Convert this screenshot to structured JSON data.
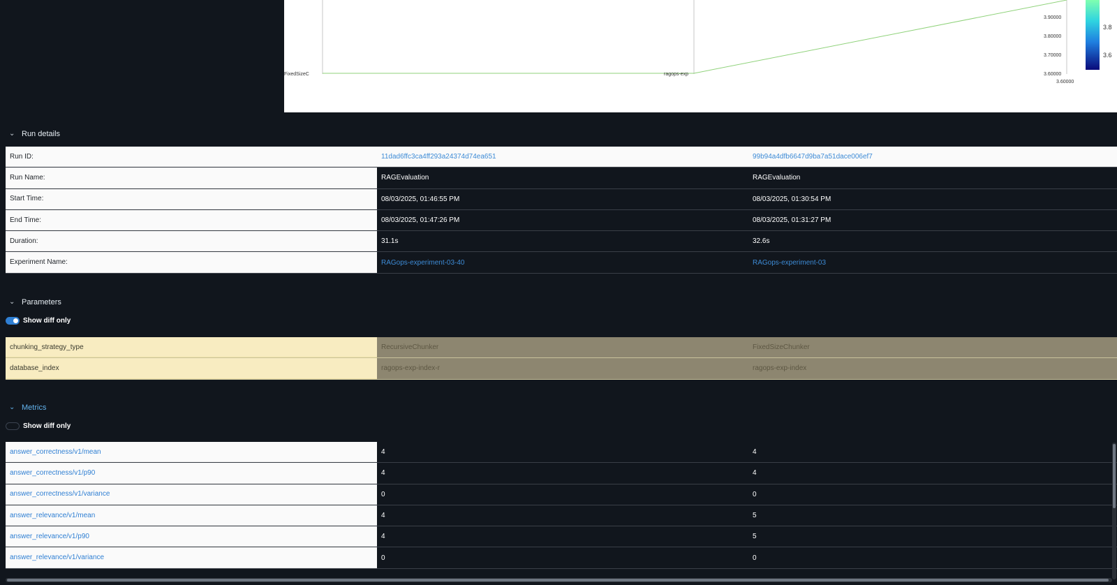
{
  "chart": {
    "axis_labels": {
      "left": "FixedSizeC",
      "middle": "ragops-exp",
      "right_ticks": [
        "3.90000",
        "3.80000",
        "3.70000",
        "3.60000"
      ],
      "bottom_tick": "3.60000"
    },
    "colorbar_ticks": [
      "3.8",
      "3.6"
    ],
    "colors": {
      "line": "#8fd27a",
      "axis": "#c7c7c7"
    }
  },
  "run_details": {
    "header": "Run details",
    "rows": [
      {
        "label": "Run ID:",
        "values": [
          "11dad6ffc3ca4ff293a24374d74ea651",
          "99b94a4dfb6647d9ba7a51dace006ef7"
        ],
        "link": true
      },
      {
        "label": "Run Name:",
        "values": [
          "RAGEvaluation",
          "RAGEvaluation"
        ]
      },
      {
        "label": "Start Time:",
        "values": [
          "08/03/2025, 01:46:55 PM",
          "08/03/2025, 01:30:54 PM"
        ]
      },
      {
        "label": "End Time:",
        "values": [
          "08/03/2025, 01:47:26 PM",
          "08/03/2025, 01:31:27 PM"
        ]
      },
      {
        "label": "Duration:",
        "values": [
          "31.1s",
          "32.6s"
        ]
      },
      {
        "label": "Experiment Name:",
        "values": [
          "RAGops-experiment-03-40",
          "RAGops-experiment-03"
        ],
        "link": true
      }
    ]
  },
  "parameters": {
    "header": "Parameters",
    "toggle_label": "Show diff only",
    "toggle_on": true,
    "rows": [
      {
        "label": "chunking_strategy_type",
        "values": [
          "RecursiveChunker",
          "FixedSizeChunker"
        ]
      },
      {
        "label": "database_index",
        "values": [
          "ragops-exp-index-r",
          "ragops-exp-index"
        ]
      }
    ]
  },
  "metrics": {
    "header": "Metrics",
    "toggle_label": "Show diff only",
    "toggle_on": false,
    "rows": [
      {
        "label": "answer_correctness/v1/mean",
        "values": [
          "4",
          "4"
        ]
      },
      {
        "label": "answer_correctness/v1/p90",
        "values": [
          "4",
          "4"
        ]
      },
      {
        "label": "answer_correctness/v1/variance",
        "values": [
          "0",
          "0"
        ]
      },
      {
        "label": "answer_relevance/v1/mean",
        "values": [
          "4",
          "5"
        ]
      },
      {
        "label": "answer_relevance/v1/p90",
        "values": [
          "4",
          "5"
        ]
      },
      {
        "label": "answer_relevance/v1/variance",
        "values": [
          "0",
          "0"
        ]
      }
    ]
  }
}
